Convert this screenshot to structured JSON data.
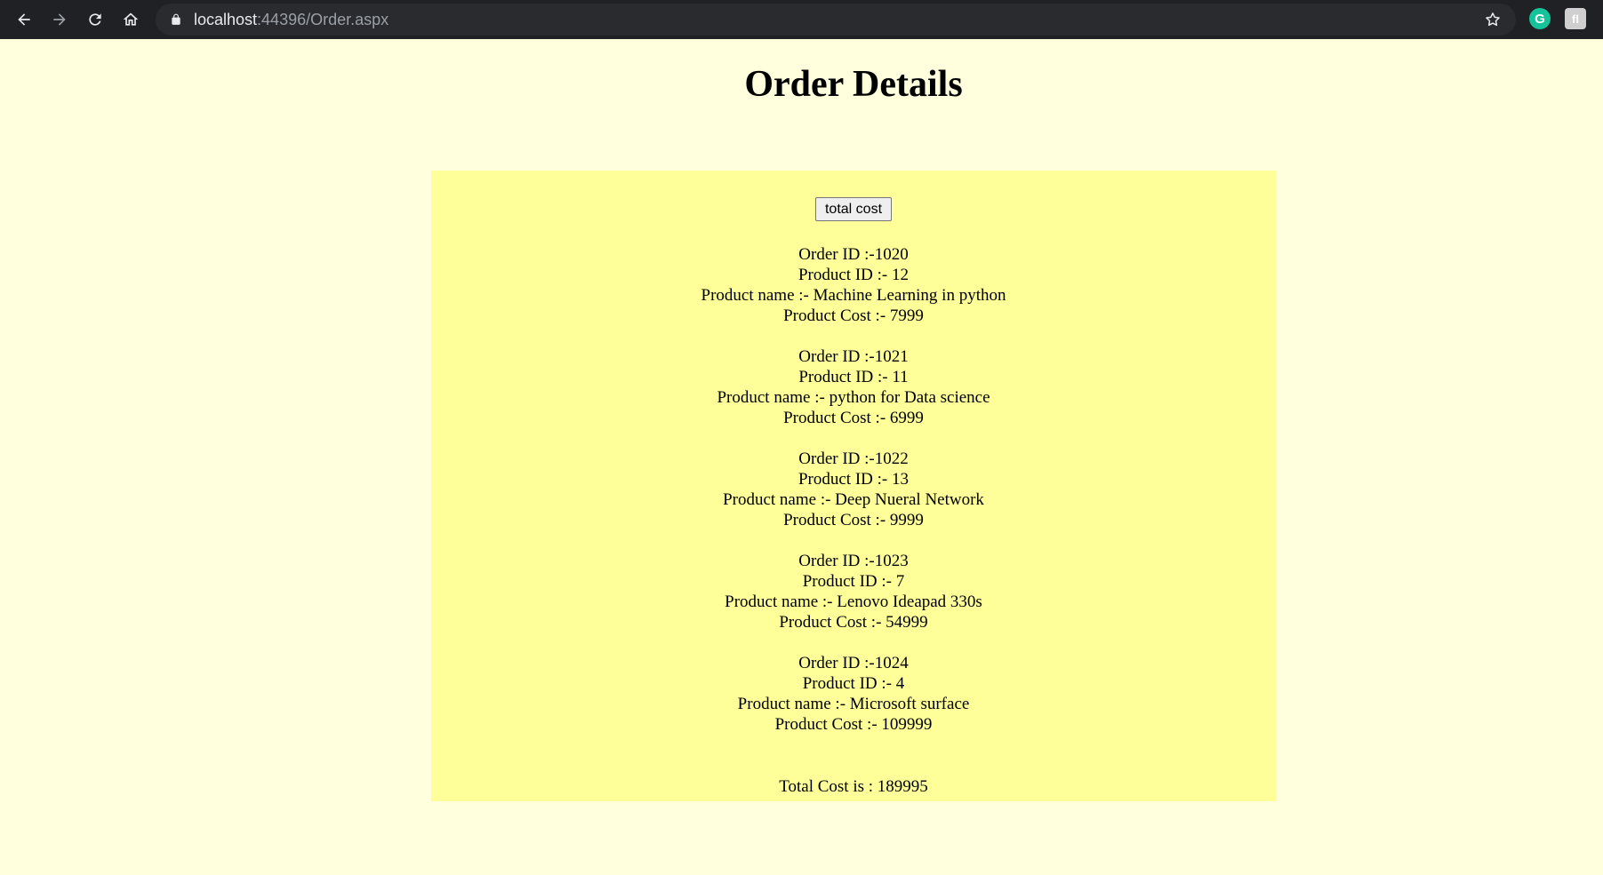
{
  "browser": {
    "url_host": "localhost",
    "url_rest": ":44396/Order.aspx",
    "icons": [
      "back-icon",
      "forward-icon",
      "reload-icon",
      "home-icon",
      "lock-icon",
      "star-icon",
      "grammarly-icon",
      "extension-icon"
    ],
    "extension_g_letter": "G",
    "extension_letter": "fl"
  },
  "page": {
    "title": "Order Details",
    "button_label": "total cost",
    "orders": [
      {
        "order_id": "Order ID :-1020",
        "product_id": "Product ID :- 12",
        "product_name": "Product name :- Machine Learning in python",
        "product_cost": "Product Cost :- 7999"
      },
      {
        "order_id": "Order ID :-1021",
        "product_id": "Product ID :- 11",
        "product_name": "Product name :- python for Data science",
        "product_cost": "Product Cost :- 6999"
      },
      {
        "order_id": "Order ID :-1022",
        "product_id": "Product ID :- 13",
        "product_name": "Product name :- Deep Nueral Network",
        "product_cost": "Product Cost :- 9999"
      },
      {
        "order_id": "Order ID :-1023",
        "product_id": "Product ID :- 7",
        "product_name": "Product name :- Lenovo Ideapad 330s",
        "product_cost": "Product Cost :- 54999"
      },
      {
        "order_id": "Order ID :-1024",
        "product_id": "Product ID :- 4",
        "product_name": "Product name :- Microsoft surface",
        "product_cost": "Product Cost :- 109999"
      }
    ],
    "total_text": "Total Cost is : 189995"
  },
  "colors": {
    "page_background": "#ffffde",
    "panel_background": "#ffff99",
    "toolbar_background": "#202124"
  }
}
